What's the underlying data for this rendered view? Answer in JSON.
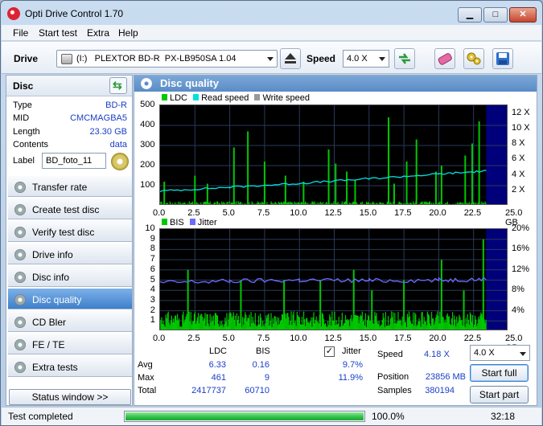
{
  "window": {
    "title": "Opti Drive Control 1.70",
    "minimize": "▁",
    "maximize": "□",
    "close": "✕"
  },
  "menu": [
    "File",
    "Start test",
    "Extra",
    "Help"
  ],
  "toolbar": {
    "drive_label": "Drive",
    "drive_value": "(I:)   PLEXTOR BD-R  PX-LB950SA 1.04",
    "speed_label": "Speed",
    "speed_value": "4.0 X"
  },
  "disc": {
    "header": "Disc",
    "fields": [
      {
        "key": "Type",
        "value": "BD-R"
      },
      {
        "key": "MID",
        "value": "CMCMAGBA5"
      },
      {
        "key": "Length",
        "value": "23.30 GB"
      },
      {
        "key": "Contents",
        "value": "data"
      }
    ],
    "label_key": "Label",
    "label_value": "BD_foto_11"
  },
  "nav": [
    {
      "label": "Transfer rate",
      "active": false
    },
    {
      "label": "Create test disc",
      "active": false
    },
    {
      "label": "Verify test disc",
      "active": false
    },
    {
      "label": "Drive info",
      "active": false
    },
    {
      "label": "Disc info",
      "active": false
    },
    {
      "label": "Disc quality",
      "active": true
    },
    {
      "label": "CD Bler",
      "active": false
    },
    {
      "label": "FE / TE",
      "active": false
    },
    {
      "label": "Extra tests",
      "active": false
    }
  ],
  "status_window_btn": "Status window >>",
  "panel": {
    "title": "Disc quality"
  },
  "chart_data": [
    {
      "type": "bar",
      "legend": [
        "LDC",
        "Read speed",
        "Write speed"
      ],
      "colors": {
        "LDC": "#00c800",
        "Read speed": "#00e0e0",
        "Write speed": "#9a9a9a"
      },
      "x_ticks": [
        "0.0",
        "2.5",
        "5.0",
        "7.5",
        "10.0",
        "12.5",
        "15.0",
        "17.5",
        "20.0",
        "22.5",
        "25.0 GB"
      ],
      "xlim": [
        0,
        25
      ],
      "y_left_ticks": [
        "500",
        "400",
        "300",
        "200",
        "100"
      ],
      "ylim_left": [
        0,
        500
      ],
      "y_right_ticks": [
        "12 X",
        "10 X",
        "8 X",
        "6 X",
        "4 X",
        "2 X"
      ],
      "ylim_right": [
        0,
        13
      ],
      "ldc_baseline": 15,
      "ldc_spikes": [
        [
          0.3,
          120
        ],
        [
          2.5,
          150
        ],
        [
          3.4,
          110
        ],
        [
          5.3,
          290
        ],
        [
          6.3,
          370
        ],
        [
          7.5,
          220
        ],
        [
          9.0,
          150
        ],
        [
          10.3,
          120
        ],
        [
          12.1,
          280
        ],
        [
          12.6,
          210
        ],
        [
          13.4,
          170
        ],
        [
          14.0,
          130
        ],
        [
          16.4,
          440
        ],
        [
          16.8,
          110
        ],
        [
          17.7,
          220
        ],
        [
          18.4,
          330
        ],
        [
          19.8,
          170
        ],
        [
          20.2,
          200
        ],
        [
          21.9,
          250
        ],
        [
          22.4,
          310
        ],
        [
          22.9,
          420
        ]
      ],
      "read_speed": {
        "x": [
          0,
          5,
          10,
          15,
          20,
          23.4
        ],
        "y": [
          1.9,
          2.4,
          2.9,
          3.5,
          4.1,
          4.5
        ]
      }
    },
    {
      "type": "bar",
      "legend": [
        "BIS",
        "Jitter"
      ],
      "colors": {
        "BIS": "#00c800",
        "Jitter": "#6b6bff"
      },
      "x_ticks": [
        "0.0",
        "2.5",
        "5.0",
        "7.5",
        "10.0",
        "12.5",
        "15.0",
        "17.5",
        "20.0",
        "22.5",
        "25.0 GB"
      ],
      "xlim": [
        0,
        25
      ],
      "y_left_ticks": [
        "10",
        "9",
        "8",
        "7",
        "6",
        "5",
        "4",
        "3",
        "2",
        "1"
      ],
      "ylim_left": [
        0,
        10
      ],
      "y_right_ticks": [
        "20%",
        "16%",
        "12%",
        "8%",
        "4%"
      ],
      "ylim_right": [
        0,
        20
      ],
      "bis_spikes": [
        [
          2.0,
          6
        ],
        [
          5.8,
          5
        ],
        [
          8.9,
          5
        ],
        [
          11.5,
          5
        ],
        [
          13.9,
          6
        ],
        [
          15.2,
          4
        ],
        [
          17.5,
          5
        ],
        [
          20.2,
          7
        ],
        [
          21.8,
          4
        ],
        [
          23.2,
          9
        ]
      ],
      "jitter": {
        "x": [
          0,
          5,
          10,
          15,
          20,
          23.4
        ],
        "y": [
          9.5,
          9.8,
          10.0,
          9.9,
          10.0,
          10.2
        ]
      }
    }
  ],
  "stats": {
    "col_ldc": "LDC",
    "col_bis": "BIS",
    "col_jitter": "Jitter",
    "rows": [
      {
        "label": "Avg",
        "ldc": "6.33",
        "bis": "0.16",
        "jitter": "9.7%"
      },
      {
        "label": "Max",
        "ldc": "461",
        "bis": "9",
        "jitter": "11.9%"
      },
      {
        "label": "Total",
        "ldc": "2417737",
        "bis": "60710",
        "jitter": ""
      }
    ],
    "jitter_checked": "✓",
    "speed_label": "Speed",
    "speed_value": "4.18 X",
    "position_label": "Position",
    "position_value": "23856 MB",
    "samples_label": "Samples",
    "samples_value": "380194",
    "speed_select": "4.0 X",
    "start_full": "Start full",
    "start_part": "Start part"
  },
  "status": {
    "text": "Test completed",
    "progress_text": "100.0%",
    "progress": 1.0,
    "time": "32:18"
  }
}
